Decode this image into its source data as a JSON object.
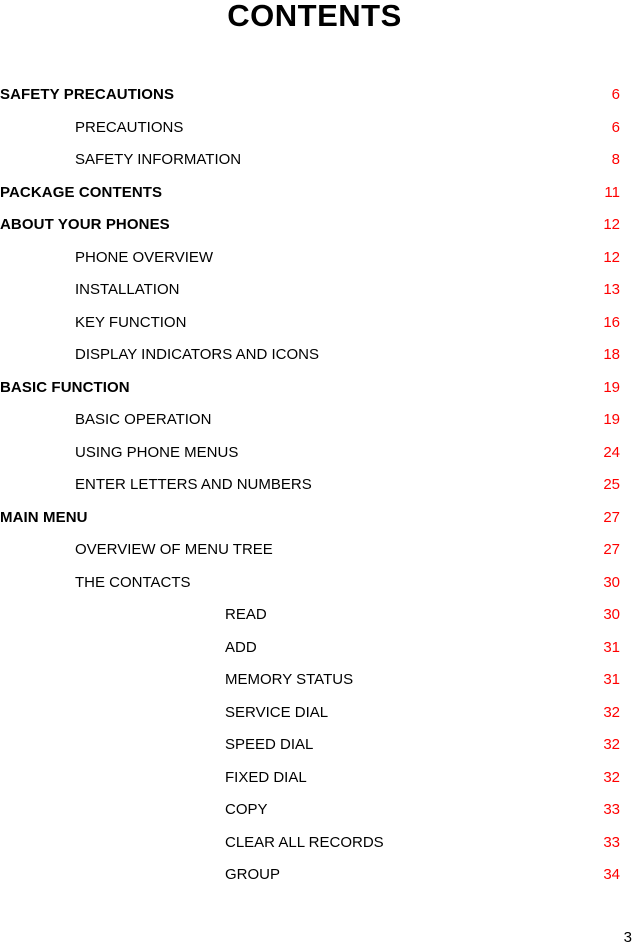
{
  "document": {
    "title": "CONTENTS",
    "folio": "3"
  },
  "toc": {
    "entries": [
      {
        "label": "SAFETY PRECAUTIONS",
        "page": "6",
        "level": 1
      },
      {
        "label": "PRECAUTIONS",
        "page": "6",
        "level": 2
      },
      {
        "label": "SAFETY INFORMATION",
        "page": "8",
        "level": 2
      },
      {
        "label": "PACKAGE CONTENTS",
        "page": "11",
        "level": 1
      },
      {
        "label": "ABOUT YOUR PHONES",
        "page": "12",
        "level": 1
      },
      {
        "label": "PHONE OVERVIEW",
        "page": "12",
        "level": 2
      },
      {
        "label": "INSTALLATION",
        "page": "13",
        "level": 2
      },
      {
        "label": "KEY FUNCTION",
        "page": "16",
        "level": 2
      },
      {
        "label": "DISPLAY INDICATORS AND ICONS",
        "page": "18",
        "level": 2
      },
      {
        "label": "BASIC FUNCTION",
        "page": "19",
        "level": 1
      },
      {
        "label": "BASIC OPERATION",
        "page": "19",
        "level": 2
      },
      {
        "label": "USING PHONE MENUS",
        "page": "24",
        "level": 2
      },
      {
        "label": "ENTER LETTERS AND NUMBERS",
        "page": "25",
        "level": 2
      },
      {
        "label": "MAIN MENU",
        "page": "27",
        "level": 1
      },
      {
        "label": "OVERVIEW OF MENU TREE",
        "page": "27",
        "level": 2
      },
      {
        "label": "THE CONTACTS",
        "page": "30",
        "level": 2
      },
      {
        "label": "READ",
        "page": "30",
        "level": 3
      },
      {
        "label": "ADD",
        "page": "31",
        "level": 3
      },
      {
        "label": "MEMORY STATUS",
        "page": "31",
        "level": 3
      },
      {
        "label": "SERVICE DIAL",
        "page": "32",
        "level": 3
      },
      {
        "label": "SPEED DIAL",
        "page": "32",
        "level": 3
      },
      {
        "label": "FIXED DIAL",
        "page": "32",
        "level": 3
      },
      {
        "label": "COPY",
        "page": "33",
        "level": 3
      },
      {
        "label": "CLEAR ALL RECORDS",
        "page": "33",
        "level": 3
      },
      {
        "label": "GROUP",
        "page": "34",
        "level": 3
      }
    ]
  },
  "colors": {
    "page_number": "#ff0000",
    "text": "#000000",
    "background": "#ffffff"
  }
}
